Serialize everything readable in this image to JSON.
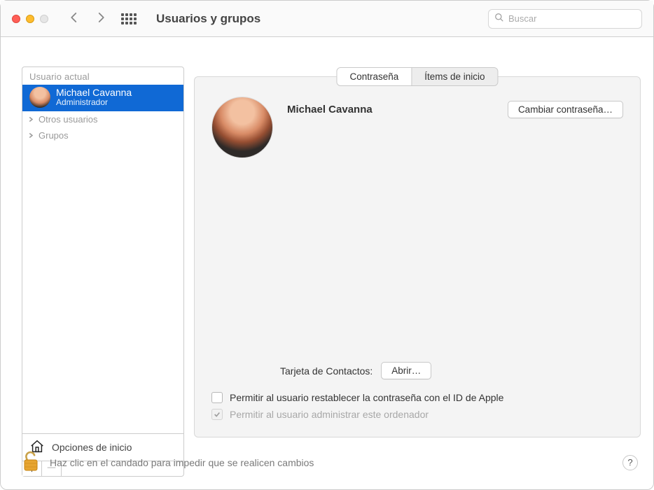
{
  "window": {
    "title": "Usuarios y grupos",
    "search_placeholder": "Buscar"
  },
  "sidebar": {
    "section_label": "Usuario actual",
    "current_user": {
      "name": "Michael Cavanna",
      "role": "Administrador"
    },
    "items": [
      {
        "label": "Otros usuarios"
      },
      {
        "label": "Grupos"
      }
    ],
    "login_options_label": "Opciones de inicio"
  },
  "tabs": {
    "password": "Contraseña",
    "login_items": "Ítems de inicio",
    "active": "password"
  },
  "main": {
    "user_name": "Michael Cavanna",
    "change_password_label": "Cambiar contraseña…",
    "contacts_card_label": "Tarjeta de Contactos:",
    "open_label": "Abrir…",
    "checkbox_reset_apple_id": "Permitir al usuario restablecer la contraseña con el ID de Apple",
    "checkbox_admin": "Permitir al usuario administrar este ordenador"
  },
  "footer": {
    "lock_text": "Haz clic en el candado para impedir que se realicen cambios",
    "help_label": "?"
  }
}
